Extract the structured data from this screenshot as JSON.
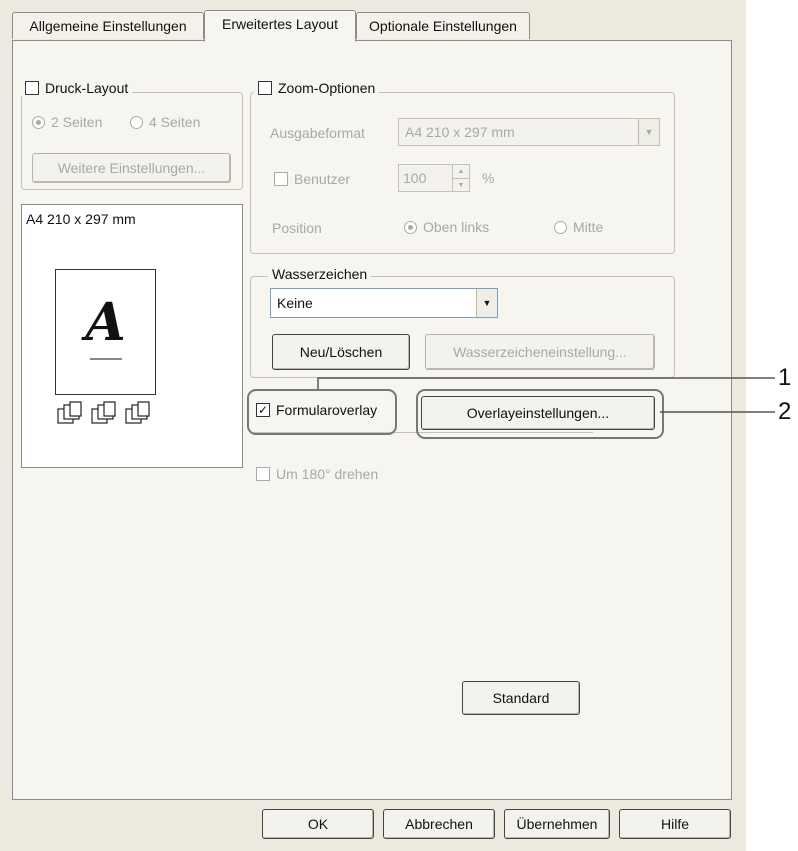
{
  "tabs": [
    {
      "label": "Allgemeine Einstellungen",
      "active": false
    },
    {
      "label": "Erweitertes Layout",
      "active": true
    },
    {
      "label": "Optionale Einstellungen",
      "active": false
    }
  ],
  "druck_layout": {
    "label": "Druck-Layout",
    "checked": false,
    "option_2": "2 Seiten",
    "option_4": "4 Seiten",
    "more_button": "Weitere Einstellungen..."
  },
  "preview": {
    "paper_label": "A4 210 x 297 mm",
    "page_letter": "A"
  },
  "zoom": {
    "label": "Zoom-Optionen",
    "checked": false,
    "output_label": "Ausgabeformat",
    "output_value": "A4 210 x 297 mm",
    "custom_label": "Benutzer",
    "custom_value": "100",
    "custom_unit": "%",
    "position_label": "Position",
    "pos_top_left": "Oben links",
    "pos_center": "Mitte"
  },
  "watermark": {
    "label": "Wasserzeichen",
    "value": "Keine",
    "new_delete_button": "Neu/Löschen",
    "settings_button": "Wasserzeicheneinstellung..."
  },
  "overlay": {
    "checkbox_label": "Formularoverlay",
    "checked": true,
    "settings_button": "Overlayeinstellungen..."
  },
  "rotate": {
    "label": "Um 180° drehen",
    "checked": false
  },
  "standard_button": "Standard",
  "footer": {
    "ok": "OK",
    "cancel": "Abbrechen",
    "apply": "Übernehmen",
    "help": "Hilfe"
  },
  "callouts": [
    "1",
    "2"
  ],
  "colors": {
    "dialog_bg": "#ece9df",
    "panel_bg": "#f6f5ef",
    "disabled_text": "#a8a8a8"
  }
}
